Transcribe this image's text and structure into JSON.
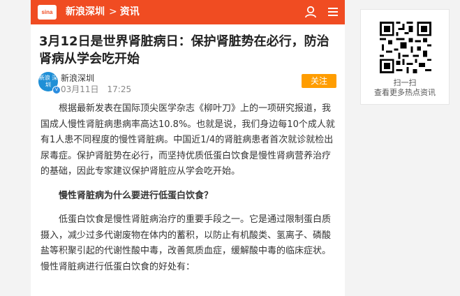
{
  "header": {
    "logo_text": "sina",
    "site_name": "新浪深圳",
    "separator": ">",
    "section": "资讯",
    "brand_color": "#f04c22"
  },
  "article": {
    "title": "3月12日是世界肾脏病日：保护肾脏势在必行，防治肾病从学会吃开始",
    "author": "新浪深圳",
    "avatar_text": "新浪 深圳",
    "time": "03月11日　17:25",
    "follow_label": "关注",
    "paragraphs": [
      "根据最新发表在国际顶尖医学杂志《柳叶刀》上的一项研究报道，我国成人慢性肾脏病患病率高达10.8%。也就是说，我们身边每10个成人就有1人患不同程度的慢性肾脏病。中国近1/4的肾脏病患者首次就诊就检出尿毒症。保护肾脏势在必行，而坚持优质低蛋白饮食是慢性肾病营养治疗的基础，因此专家建议保护肾脏应从学会吃开始。",
      "慢性肾脏病为什么要进行低蛋白饮食？",
      "低蛋白饮食是慢性肾脏病治疗的重要手段之一。它是通过限制蛋白质摄入，减少过多代谢废物在体内的蓄积，以防止有机酸类、氢离子、磷酸盐等积聚引起的代谢性酸中毒，改善氮质血症，缓解酸中毒的临床症状。慢性肾脏病进行低蛋白饮食的好处有："
    ]
  },
  "sidebar": {
    "qr_caption_1": "扫一扫",
    "qr_caption_2": "查看更多热点资讯"
  }
}
